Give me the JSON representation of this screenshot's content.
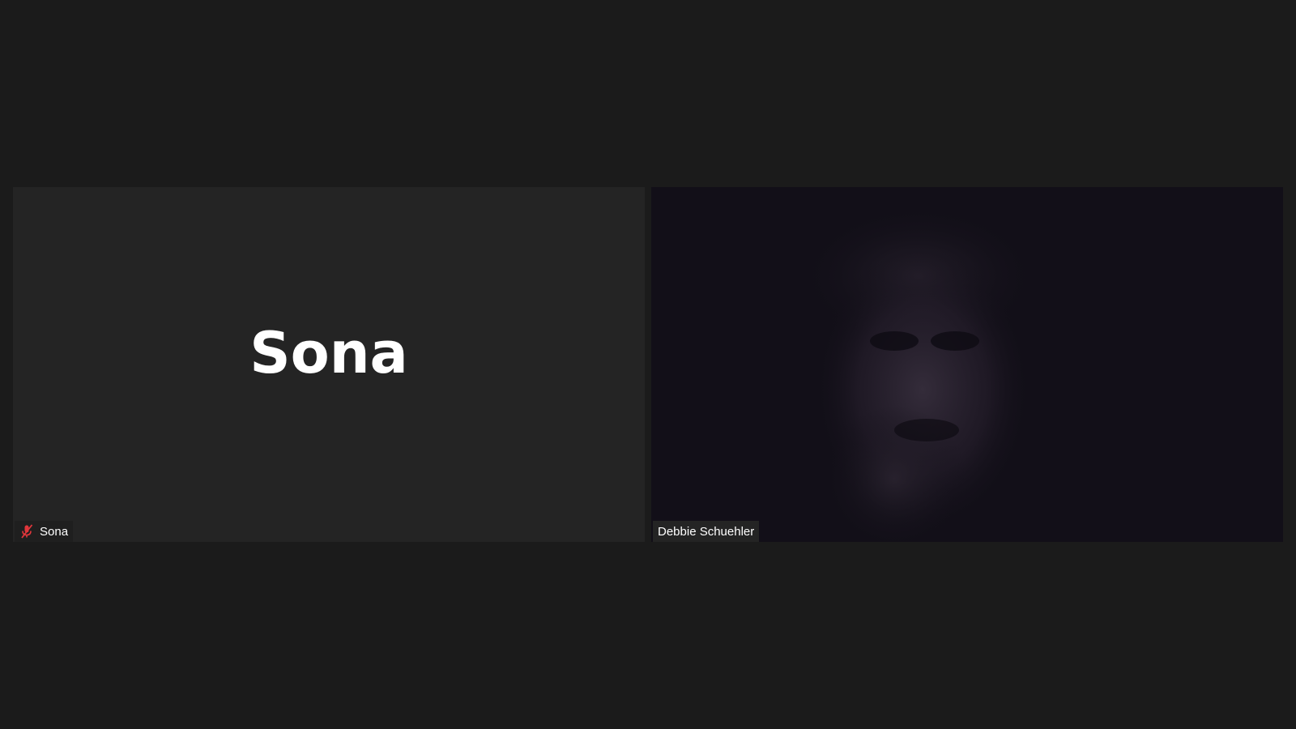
{
  "participants": [
    {
      "display_name_large": "Sona",
      "name_tag": "Sona",
      "muted": true,
      "icon": "mic-muted-icon",
      "tile_color": "#242424"
    },
    {
      "name_tag": "Debbie Schuehler",
      "muted": false,
      "video": "dark-webcam-feed",
      "tile_color": "#120f18"
    }
  ],
  "colors": {
    "background": "#1b1b1b",
    "muted_icon": "#e0363b",
    "name_text": "#ffffff"
  }
}
